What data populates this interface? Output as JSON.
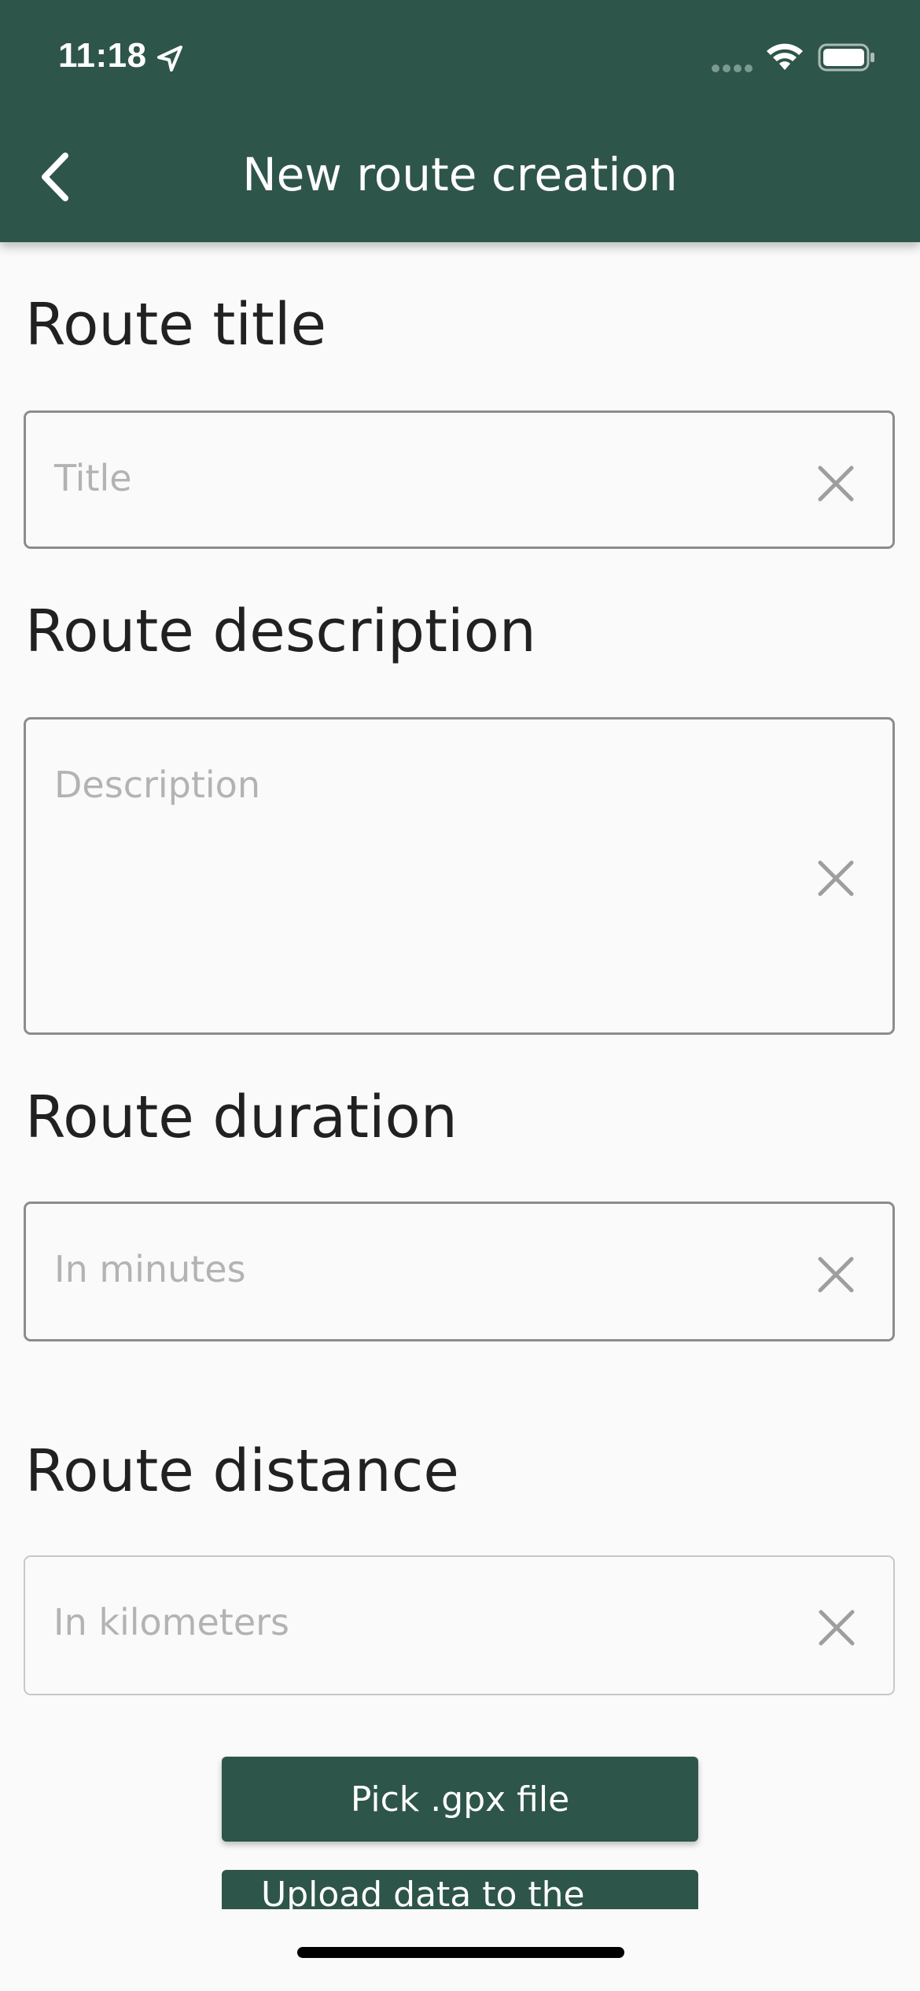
{
  "status_bar": {
    "time": "11:18",
    "icons": [
      "location-arrow-icon",
      "signal-icon",
      "wifi-icon",
      "battery-icon"
    ]
  },
  "appbar": {
    "title": "New route creation",
    "back_icon": "chevron-left-icon",
    "background": "#2e5549"
  },
  "form": {
    "title": {
      "label": "Route title",
      "placeholder": "Title",
      "value": ""
    },
    "description": {
      "label": "Route description",
      "placeholder": "Description",
      "value": ""
    },
    "duration": {
      "label": "Route duration",
      "placeholder": "In minutes",
      "value": ""
    },
    "distance": {
      "label": "Route distance",
      "placeholder": "In kilometers",
      "value": ""
    },
    "clear_icon": "close-icon"
  },
  "actions": {
    "pick_gpx": "Pick .gpx file",
    "upload": "Upload data to the"
  },
  "colors": {
    "primary": "#2e5549",
    "background": "#fafafa",
    "placeholder": "#b3b3b3",
    "border": "#8c8c8c"
  }
}
